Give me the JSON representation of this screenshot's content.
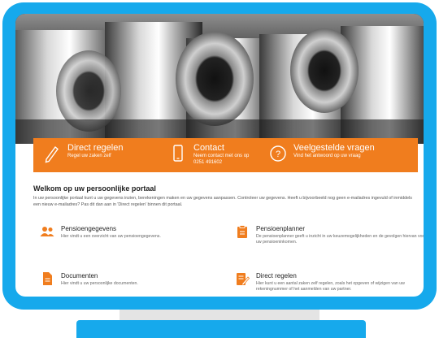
{
  "banner": {
    "items": [
      {
        "icon": "pencil-icon",
        "title": "Direct regelen",
        "subtitle": "Regel uw zaken zelf"
      },
      {
        "icon": "phone-icon",
        "title": "Contact",
        "subtitle": "Neem contact met ons op",
        "extra": "0251 491602"
      },
      {
        "icon": "question-icon",
        "title": "Veelgestelde vragen",
        "subtitle": "Vind het antwoord op uw vraag"
      }
    ]
  },
  "welcome": {
    "title": "Welkom op uw persoonlijke portaal",
    "text": "In uw persoonlijke portaal kunt u uw gegevens inzien, berekeningen maken en uw gegevens aanpassen. Controleer uw gegevens. Heeft u bijvoorbeeld nog geen e-mailadres ingevuld of inmiddels een nieuw e-mailadres? Pas dit dan aan in 'Direct regelen' binnen dit portaal."
  },
  "cards": [
    {
      "icon": "users-icon",
      "title": "Pensioengegevens",
      "desc": "Hier vindt u een overzicht van uw pensioengegevens."
    },
    {
      "icon": "clipboard-icon",
      "title": "Pensioenplanner",
      "desc": "De pensioenplanner geeft u inzicht in uw keuzemogelijkheden en de gevolgen hiervan voor uw pensioeninkomen."
    },
    {
      "icon": "document-icon",
      "title": "Documenten",
      "desc": "Hier vindt u uw persoonlijke documenten."
    },
    {
      "icon": "edit-form-icon",
      "title": "Direct regelen",
      "desc": "Hier kunt u een aantal zaken zelf regelen, zoals het opgeven of wijzigen van uw rekeningnummer of het aanmelden van uw partner."
    }
  ],
  "colors": {
    "frame": "#16a9ec",
    "accent": "#f07d1e"
  }
}
